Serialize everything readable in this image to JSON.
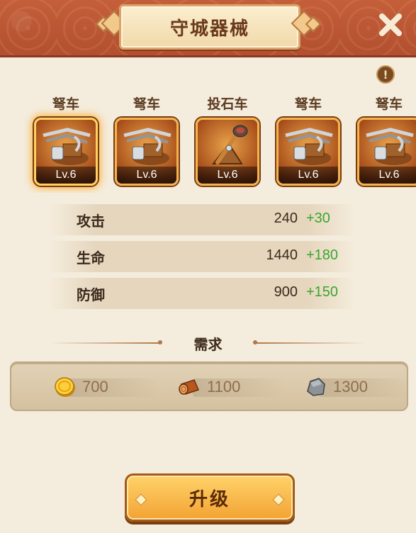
{
  "header": {
    "title": "守城器械"
  },
  "info": {
    "symbol": "!"
  },
  "weapons": [
    {
      "name": "弩车",
      "level": "Lv.6",
      "type": "crossbow",
      "selected": true
    },
    {
      "name": "弩车",
      "level": "Lv.6",
      "type": "crossbow",
      "selected": false
    },
    {
      "name": "投石车",
      "level": "Lv.6",
      "type": "catapult",
      "selected": false
    },
    {
      "name": "弩车",
      "level": "Lv.6",
      "type": "crossbow",
      "selected": false
    },
    {
      "name": "弩车",
      "level": "Lv.6",
      "type": "crossbow",
      "selected": false
    }
  ],
  "stats": [
    {
      "label": "攻击",
      "value": "240",
      "bonus": "+30"
    },
    {
      "label": "生命",
      "value": "1440",
      "bonus": "+180"
    },
    {
      "label": "防御",
      "value": "900",
      "bonus": "+150"
    }
  ],
  "requirements": {
    "title": "需求",
    "items": [
      {
        "icon": "gold-coin-icon",
        "amount": "700"
      },
      {
        "icon": "wood-log-icon",
        "amount": "1100"
      },
      {
        "icon": "stone-icon",
        "amount": "1300"
      }
    ]
  },
  "upgrade": {
    "label": "升级"
  },
  "colors": {
    "header": "#b24f2e",
    "bonus": "#3aa62c",
    "button": "#f3a233"
  }
}
